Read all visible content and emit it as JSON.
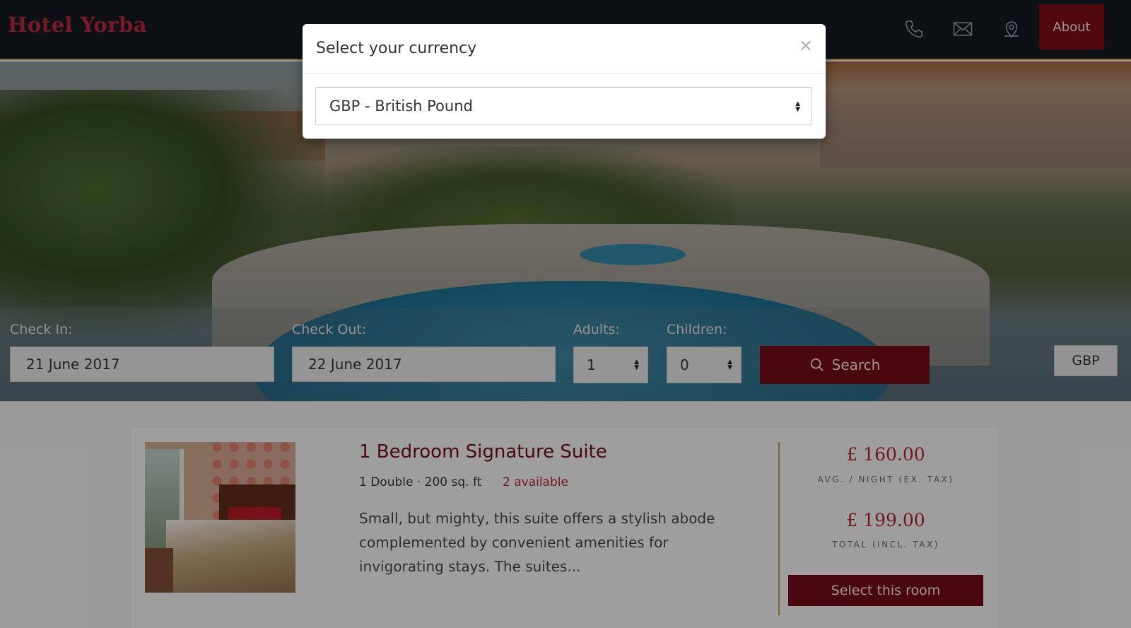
{
  "header": {
    "logo": "Hotel Yorba",
    "icons": [
      "phone-icon",
      "mail-icon",
      "map-pin-icon"
    ],
    "about_label": "About"
  },
  "search": {
    "checkin_label": "Check In:",
    "checkin_value": "21 June 2017",
    "checkout_label": "Check Out:",
    "checkout_value": "22 June 2017",
    "adults_label": "Adults:",
    "adults_value": "1",
    "children_label": "Children:",
    "children_value": "0",
    "search_label": "Search",
    "currency_label": "GBP"
  },
  "room": {
    "title": "1 Bedroom Signature Suite",
    "meta": "1 Double · 200 sq. ft",
    "availability": "2 available",
    "description": "Small, but mighty, this suite offers a stylish abode complemented by convenient amenities for invigorating stays. The suites...",
    "avg_price": "£ 160.00",
    "avg_label": "AVG. / NIGHT (EX. TAX)",
    "total_price": "£ 199.00",
    "total_label": "TOTAL (INCL. TAX)",
    "select_label": "Select this room"
  },
  "modal": {
    "title": "Select your currency",
    "close": "×",
    "selected_currency": "GBP - British Pound"
  },
  "colors": {
    "brand": "#7a0c17",
    "header_bg": "#141a21",
    "price": "#a8232f",
    "accent_line": "#c8923a"
  }
}
